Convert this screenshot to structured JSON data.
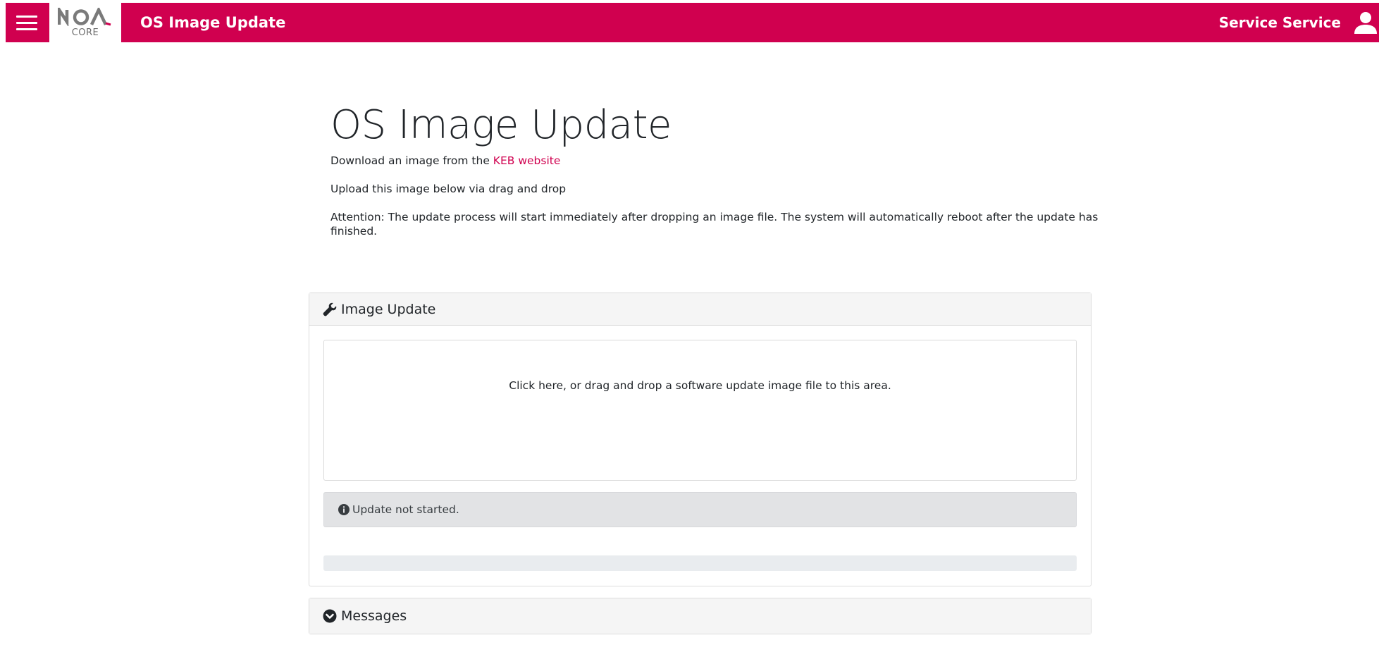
{
  "header": {
    "menu_icon": "hamburger-icon",
    "logo": {
      "brand": "NOA",
      "sub": "CORE",
      "accent_color": "#d0004f"
    },
    "title": "OS Image Update",
    "user_name": "Service Service",
    "user_icon": "person-icon",
    "bar_color": "#d0004f"
  },
  "intro": {
    "title": "OS Image Update",
    "download_prefix": "Download an image from the ",
    "download_link": "KEB website",
    "upload_text": "Upload this image below via drag and drop",
    "attention_text": "Attention: The update process will start immediately after dropping an image file. The system will automatically reboot after the update has finished."
  },
  "image_update": {
    "header_icon": "wrench-icon",
    "header": "Image Update",
    "dropzone_text": "Click here, or drag and drop a software update image file to this area.",
    "status_icon": "info-circle-icon",
    "status_text": "Update not started.",
    "progress": 0
  },
  "messages": {
    "header_icon": "chevron-circle-down-icon",
    "header": "Messages"
  }
}
